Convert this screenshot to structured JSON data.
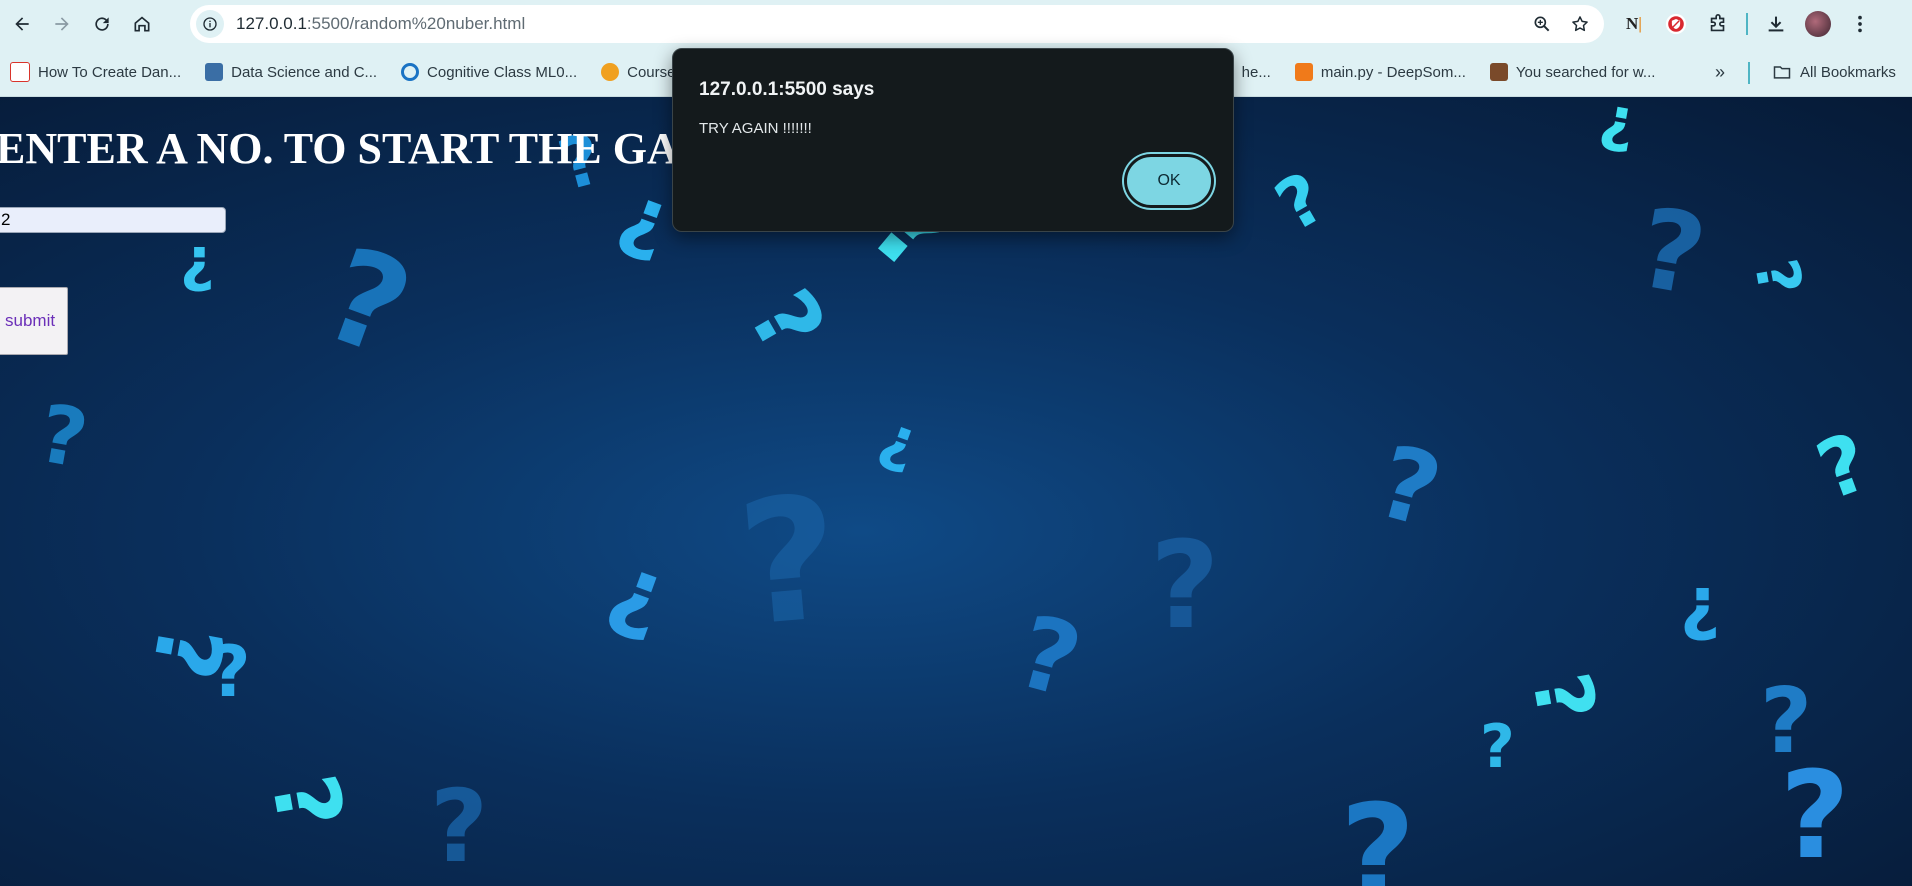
{
  "browser": {
    "url_host": "127.0.0.1",
    "url_path": ":5500/random%20nuber.html",
    "bookmarks": [
      {
        "label": "How To Create Dan...",
        "color": "#d9342b"
      },
      {
        "label": "Data Science and C...",
        "color": "#3a6ea5"
      },
      {
        "label": "Cognitive Class ML0...",
        "color": "#1a73c4"
      },
      {
        "label": "Course S",
        "color": "#f0a020"
      }
    ],
    "bookmarks_right": [
      {
        "label": "he...",
        "color": "#cfd8dc"
      },
      {
        "label": "main.py - DeepSom...",
        "color": "#f07a1a"
      },
      {
        "label": "You searched for w...",
        "color": "#7a4a2a"
      }
    ],
    "more_bookmarks": "»",
    "all_bookmarks": "All Bookmarks",
    "extension_n": "N"
  },
  "page": {
    "heading": "ENTER A NO. TO START THE GAME",
    "input_value": "2",
    "submit_label": "submit"
  },
  "dialog": {
    "title": "127.0.0.1:5500 says",
    "message": "TRY AGAIN !!!!!!!",
    "ok_label": "OK"
  },
  "colors": {
    "chrome_bg": "#dff1f4",
    "page_bg": "#0a2f5c",
    "accent": "#7dd6e3",
    "question_marks": "#2fb8e8"
  }
}
